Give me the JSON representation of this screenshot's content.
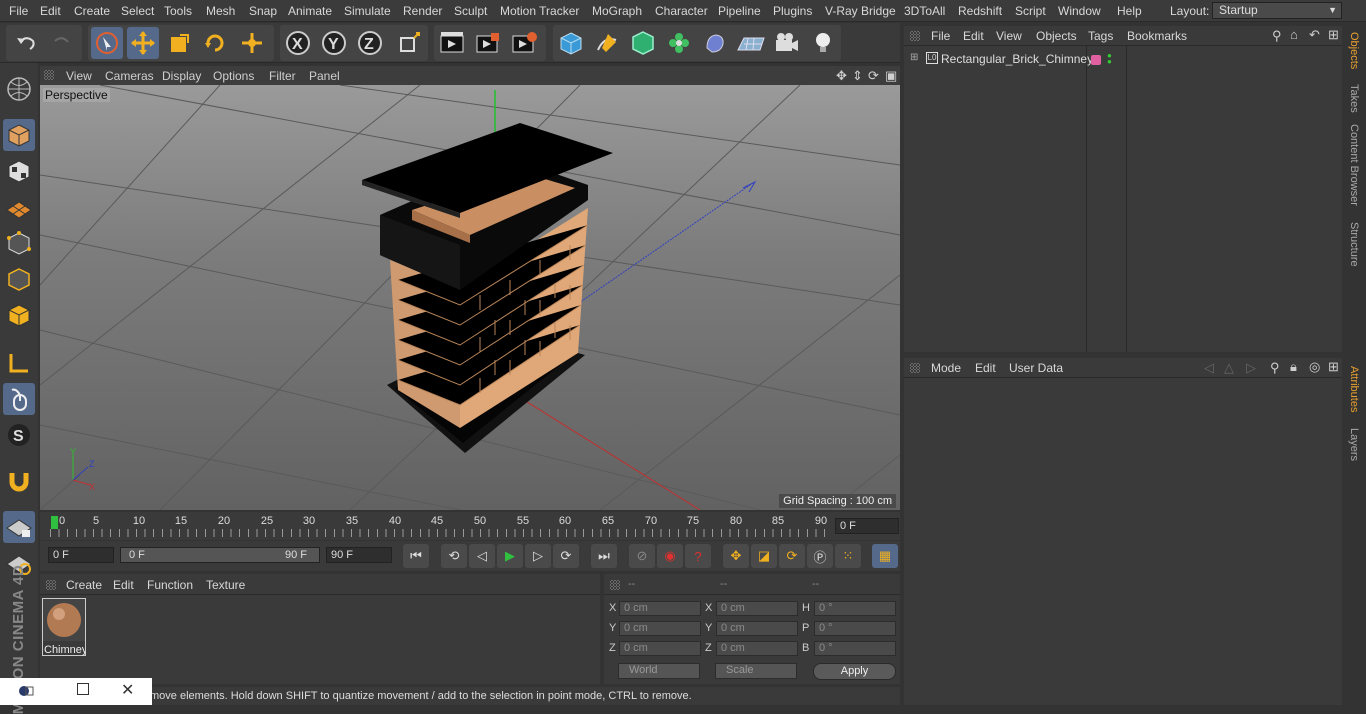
{
  "menubar": {
    "items": [
      "File",
      "Edit",
      "Create",
      "Select",
      "Tools",
      "Mesh",
      "Snap",
      "Animate",
      "Simulate",
      "Render",
      "Sculpt",
      "Motion Tracker",
      "MoGraph",
      "Character",
      "Pipeline",
      "Plugins",
      "V-Ray Bridge",
      "3DToAll",
      "Redshift",
      "Script",
      "Window",
      "Help"
    ],
    "layout_label": "Layout:",
    "layout_value": "Startup"
  },
  "viewport": {
    "menu": [
      "View",
      "Cameras",
      "Display",
      "Options",
      "Filter",
      "Panel"
    ],
    "label": "Perspective",
    "grid_spacing": "Grid Spacing : 100 cm"
  },
  "timeline": {
    "ticks": [
      "0",
      "5",
      "10",
      "15",
      "20",
      "25",
      "30",
      "35",
      "40",
      "45",
      "50",
      "55",
      "60",
      "65",
      "70",
      "75",
      "80",
      "85",
      "90"
    ],
    "current_frame": "0 F",
    "start_field": "0 F",
    "range_start": "0 F",
    "range_end": "90 F",
    "end_field": "90 F"
  },
  "materials": {
    "menu": [
      "Create",
      "Edit",
      "Function",
      "Texture"
    ],
    "items": [
      {
        "name": "Chimney"
      }
    ]
  },
  "coordinates": {
    "headers": [
      "--",
      "--",
      "--"
    ],
    "rows": [
      {
        "a": "X",
        "av": "0 cm",
        "b": "X",
        "bv": "0 cm",
        "c": "H",
        "cv": "0 °"
      },
      {
        "a": "Y",
        "av": "0 cm",
        "b": "Y",
        "bv": "0 cm",
        "c": "P",
        "cv": "0 °"
      },
      {
        "a": "Z",
        "av": "0 cm",
        "b": "Z",
        "bv": "0 cm",
        "c": "B",
        "cv": "0 °"
      }
    ],
    "mode_select": "World",
    "type_select": "Scale",
    "apply_label": "Apply"
  },
  "status": {
    "text": "move elements. Hold down SHIFT to quantize movement / add to the selection in point mode, CTRL to remove."
  },
  "objects": {
    "menu": [
      "File",
      "Edit",
      "View",
      "Objects",
      "Tags",
      "Bookmarks"
    ],
    "items": [
      {
        "name": "Rectangular_Brick_Chimney"
      }
    ]
  },
  "attributes": {
    "menu": [
      "Mode",
      "Edit",
      "User Data"
    ]
  },
  "right_tabs": [
    "Objects",
    "Takes",
    "Content Browser",
    "Structure",
    "Attributes",
    "Layers"
  ],
  "branding": {
    "logo": "MAXON CINEMA 4D"
  },
  "colors": {
    "accent": "#556a8a",
    "tab_active": "#e8a030",
    "axis_x": "#d04040",
    "axis_y": "#40c040",
    "axis_z": "#4050d0"
  }
}
